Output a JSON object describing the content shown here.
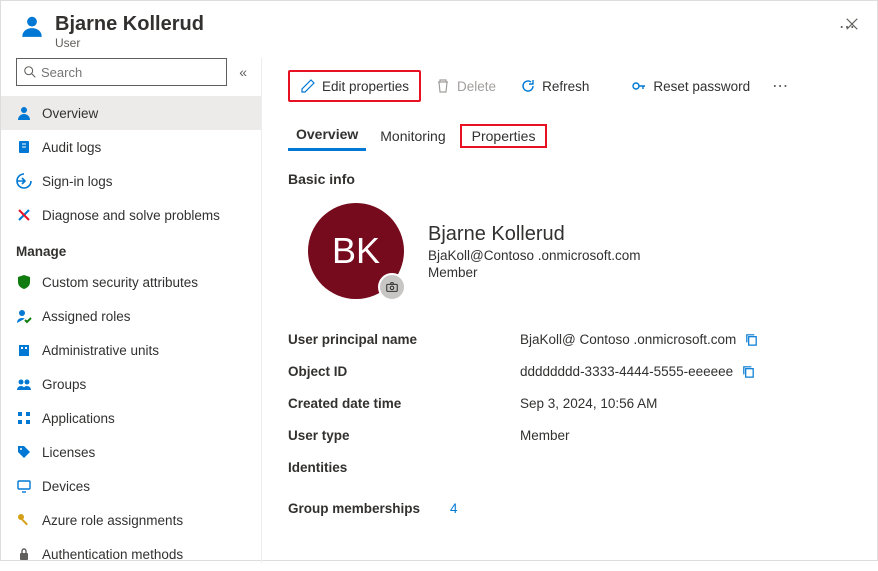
{
  "header": {
    "title": "Bjarne Kollerud",
    "subtitle": "User"
  },
  "search": {
    "placeholder": "Search"
  },
  "sidebar": {
    "items": [
      {
        "label": "Overview"
      },
      {
        "label": "Audit logs"
      },
      {
        "label": "Sign-in logs"
      },
      {
        "label": "Diagnose and solve problems"
      }
    ],
    "manage_header": "Manage",
    "manage_items": [
      {
        "label": "Custom security attributes"
      },
      {
        "label": "Assigned roles"
      },
      {
        "label": "Administrative units"
      },
      {
        "label": "Groups"
      },
      {
        "label": "Applications"
      },
      {
        "label": "Licenses"
      },
      {
        "label": "Devices"
      },
      {
        "label": "Azure role assignments"
      },
      {
        "label": "Authentication methods"
      }
    ]
  },
  "toolbar": {
    "edit": "Edit properties",
    "delete": "Delete",
    "refresh": "Refresh",
    "reset_pw": "Reset password"
  },
  "tabs": {
    "overview": "Overview",
    "monitoring": "Monitoring",
    "properties": "Properties"
  },
  "basic_info": {
    "section": "Basic info",
    "initials": "BK",
    "name": "Bjarne Kollerud",
    "email": "BjaKoll@Contoso .onmicrosoft.com",
    "membership": "Member"
  },
  "props": {
    "upn_label": "User principal name",
    "upn_value": "BjaKoll@ Contoso .onmicrosoft.com",
    "oid_label": "Object ID",
    "oid_value": "dddddddd-3333-4444-5555-eeeeee",
    "created_label": "Created date time",
    "created_value": "Sep 3, 2024, 10:56 AM",
    "utype_label": "User type",
    "utype_value": "Member",
    "identities_label": "Identities"
  },
  "group_memberships": {
    "label": "Group memberships",
    "count": "4"
  }
}
